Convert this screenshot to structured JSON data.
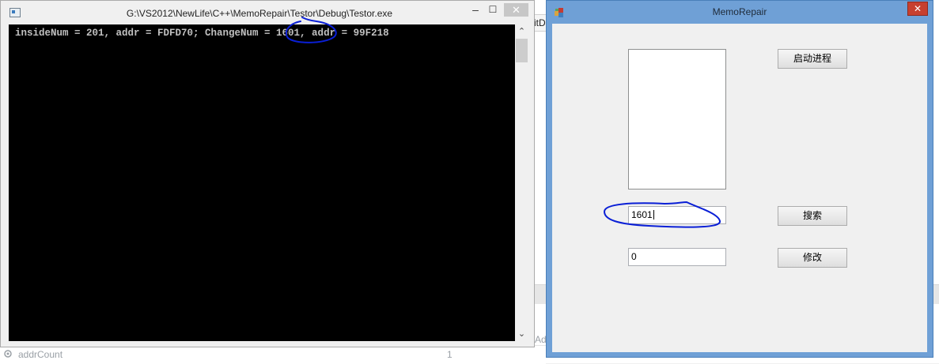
{
  "console_window": {
    "title": "G:\\VS2012\\NewLife\\C++\\MemoRepair\\Testor\\Debug\\Testor.exe",
    "output_line": "insideNum = 201, addr = FDFD70; ChangeNum = 1601, addr = 99F218",
    "min_glyph": "–",
    "max_glyph": "☐",
    "close_glyph": "✕"
  },
  "dialog": {
    "title": "MemoRepair",
    "close_glyph": "✕",
    "start_button_label": "启动进程",
    "search_input_value": "1601",
    "search_button_label": "搜索",
    "modify_input_value": "0",
    "modify_button_label": "修改"
  },
  "background": {
    "status_label": "addrCount",
    "status_value": "1",
    "ide_snippet": "itD",
    "ide_snippet_2": "Ad"
  },
  "colors": {
    "annotation": "#0a1fd6",
    "dialog_frame": "#6fa0d6",
    "console_bg": "#000000",
    "console_text": "#c0c0c0",
    "close_red": "#c7402f"
  },
  "icons": {
    "console_app": "console-app-icon",
    "dialog_app": "mfc-app-icon",
    "status": "property-icon"
  }
}
